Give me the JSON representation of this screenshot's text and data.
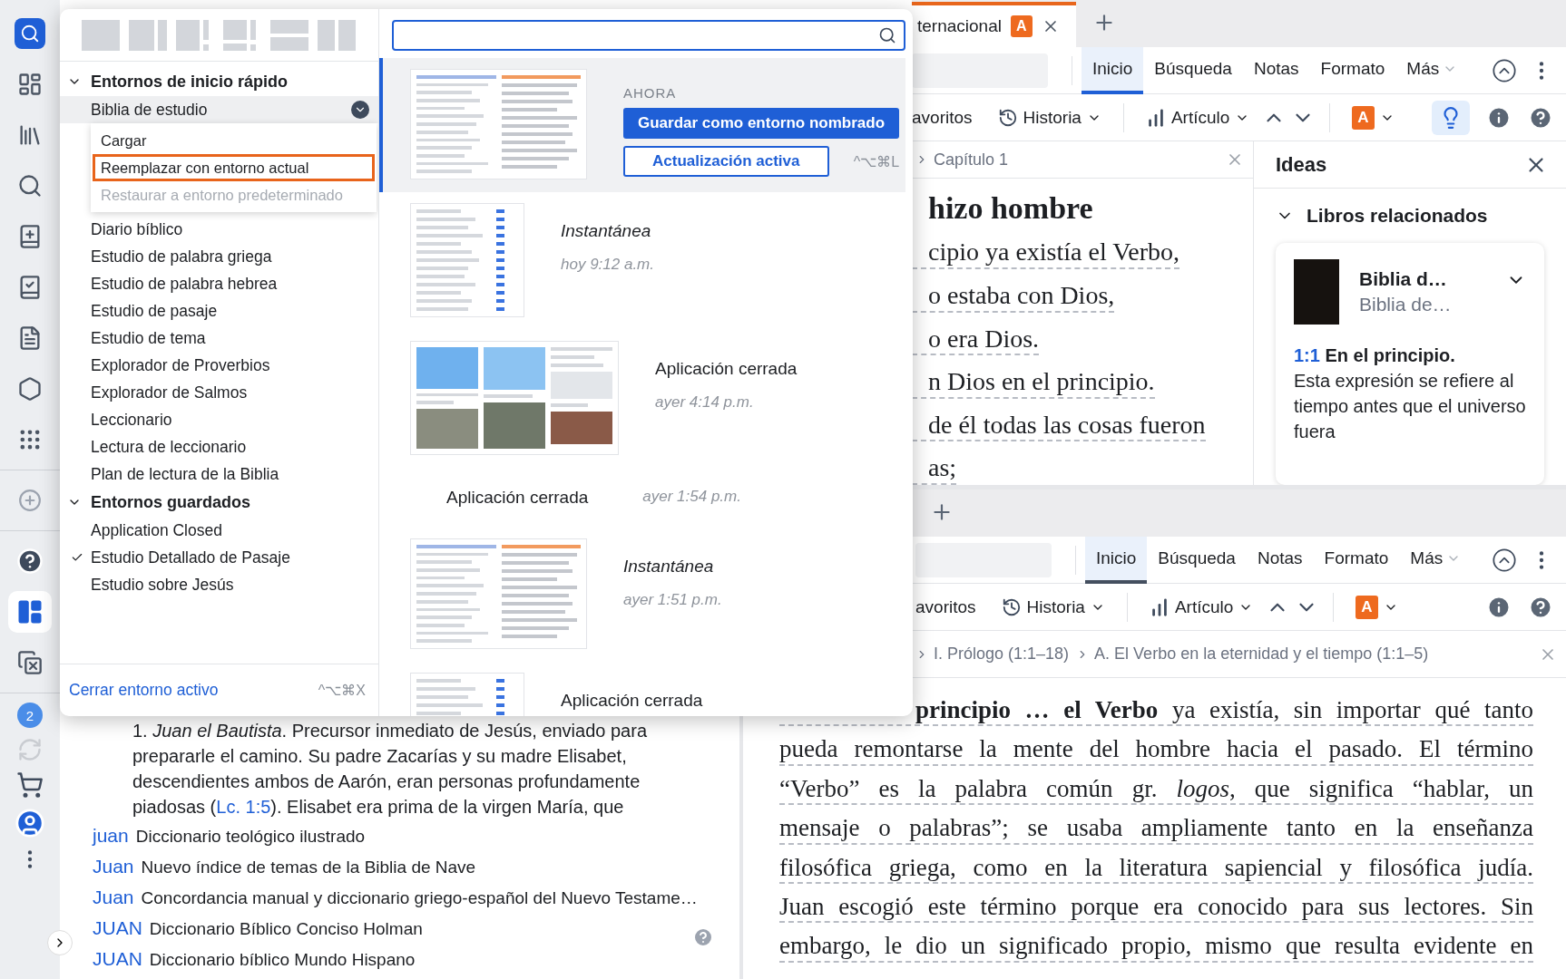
{
  "sidebar": {
    "items": [
      {
        "selected": false
      },
      {
        "selected": false
      },
      {
        "selected": false
      },
      {
        "selected": false
      },
      {
        "selected": false
      },
      {
        "selected": false
      },
      {
        "selected": false
      },
      {
        "selected": false
      },
      {
        "selected": false
      },
      {
        "selected": false
      },
      {
        "selected": false
      },
      {
        "selected": true
      },
      {
        "selected": false
      }
    ],
    "badge": "2"
  },
  "popup": {
    "sections": [
      {
        "title": "Entornos de inicio rápido",
        "expanded": true,
        "items": [
          {
            "label": "Biblia de estudio",
            "selected": true,
            "checked": false,
            "menu": [
              {
                "label": "Cargar",
                "selected": false,
                "disabled": false
              },
              {
                "label": "Reemplazar con entorno actual",
                "selected": true,
                "disabled": false
              },
              {
                "label": "Restaurar a entorno predeterminado",
                "selected": false,
                "disabled": true
              }
            ]
          },
          {
            "label": "Diario bíblico",
            "selected": false,
            "checked": false
          },
          {
            "label": "Estudio de palabra griega",
            "selected": false,
            "checked": false
          },
          {
            "label": "Estudio de palabra hebrea",
            "selected": false,
            "checked": false
          },
          {
            "label": "Estudio de pasaje",
            "selected": false,
            "checked": false
          },
          {
            "label": "Estudio de tema",
            "selected": false,
            "checked": false
          },
          {
            "label": "Explorador de Proverbios",
            "selected": false,
            "checked": false
          },
          {
            "label": "Explorador de Salmos",
            "selected": false,
            "checked": false
          },
          {
            "label": "Leccionario",
            "selected": false,
            "checked": false
          },
          {
            "label": "Lectura de leccionario",
            "selected": false,
            "checked": false
          },
          {
            "label": "Plan de lectura de la Biblia",
            "selected": false,
            "checked": false
          }
        ]
      },
      {
        "title": "Entornos guardados",
        "expanded": true,
        "items": [
          {
            "label": "Application Closed",
            "selected": false,
            "checked": false
          },
          {
            "label": "Estudio Detallado de Pasaje",
            "selected": false,
            "checked": true
          },
          {
            "label": "Estudio sobre Jesús",
            "selected": false,
            "checked": false
          }
        ]
      }
    ],
    "footer_link": "Cerrar entorno activo",
    "footer_shortcut": "^⌥⌘X",
    "snapshots": [
      {
        "kind": "current",
        "selected": true,
        "label": "AHORA",
        "primary_button": "Guardar como entorno nombrado",
        "secondary_button": "Actualización activa",
        "shortcut": "^⌥⌘L"
      },
      {
        "kind": "snapshot",
        "selected": false,
        "title": "Instantánea",
        "time": "hoy 9:12 a.m."
      },
      {
        "kind": "closed",
        "selected": false,
        "title": "Aplicación cerrada",
        "time": "ayer 4:14 p.m."
      },
      {
        "kind": "compact",
        "selected": false,
        "title": "Aplicación cerrada",
        "time": "ayer 1:54 p.m."
      },
      {
        "kind": "snapshot",
        "selected": false,
        "title": "Instantánea",
        "time": "ayer 1:51 p.m."
      },
      {
        "kind": "closed",
        "selected": false,
        "title": "Aplicación cerrada"
      }
    ]
  },
  "top_pane": {
    "focused": true,
    "tab": {
      "title": "ternacional",
      "badge": "A"
    },
    "toolbar_tabs": [
      {
        "label": "Inicio",
        "selected": true
      },
      {
        "label": "Búsqueda",
        "selected": false
      },
      {
        "label": "Notas",
        "selected": false
      },
      {
        "label": "Formato",
        "selected": false
      },
      {
        "label": "Más",
        "selected": false
      }
    ],
    "favorites": "avoritos",
    "history": "Historia",
    "article": "Artículo",
    "highlight_badge": "A",
    "insights_open": true,
    "breadcrumb": [
      "Capítulo 1"
    ],
    "heading": "hizo hombre",
    "lines": [
      "cipio ya existía el Verbo,",
      "o estaba con Dios,",
      "o era Dios.",
      "n Dios en el principio.",
      "de él todas las cosas fueron",
      "as;"
    ],
    "ideas": {
      "title": "Ideas",
      "section": "Libros relacionados",
      "expanded": true,
      "card_title": "Biblia d…",
      "card_subtitle": "Biblia de…",
      "ref": "1:1",
      "ref_heading": "En el principio.",
      "text": "Esta expresión se refiere al tiempo antes que el universo fuera"
    }
  },
  "bottom_pane": {
    "focused": false,
    "toolbar_tabs": [
      {
        "label": "Inicio",
        "selected": true
      },
      {
        "label": "Búsqueda",
        "selected": false
      },
      {
        "label": "Notas",
        "selected": false
      },
      {
        "label": "Formato",
        "selected": false
      },
      {
        "label": "Más",
        "selected": false
      }
    ],
    "favorites": "avoritos",
    "history": "Historia",
    "article": "Artículo",
    "highlight_badge": "A",
    "insights_open": false,
    "breadcrumb": [
      "I. Prólogo (1:1–18)",
      "A. El Verbo en la eternidad y el tiempo (1:1–5)"
    ],
    "lines": [
      "**principio … el Verbo** ya existía, sin importar qué tanto",
      "pueda remontarse la mente del hombre hacia el pasado. El término",
      "“Verbo” es la palabra común gr. *logos*, que significa “hablar, un",
      "mensaje o palabras”; se usaba ampliamente tanto en la enseñanza",
      "filosófica griega, como en la literatura sapiencial y filosófica judía.",
      "Juan escogió este término porque era conocido para sus lectores. Sin",
      "embargo, le dio un significado propio, mismo que resulta evidente en"
    ]
  },
  "left_pane": {
    "paragraph_before": "1. *Juan el Bautista*. Precursor inmediato de Jesús, enviado para prepararle el camino. Su padre Zacarías y su madre Elisabet, descendientes ambos de Aarón, eran personas profundamente piadosas (",
    "link": "Lc. 1:5",
    "paragraph_after": "). Elisabet era prima de la virgen María, que",
    "entries": [
      {
        "term": "juan",
        "title": "Diccionario teológico ilustrado"
      },
      {
        "term": "Juan",
        "title": "Nuevo índice de temas de la Biblia de Nave"
      },
      {
        "term": "Juan",
        "title": "Concordancia manual y diccionario griego-español del Nuevo Testame…"
      },
      {
        "term": "JUAN",
        "title": "Diccionario Bíblico Conciso Holman"
      },
      {
        "term": "JUAN",
        "title": "Diccionario bíblico Mundo Hispano"
      }
    ]
  }
}
